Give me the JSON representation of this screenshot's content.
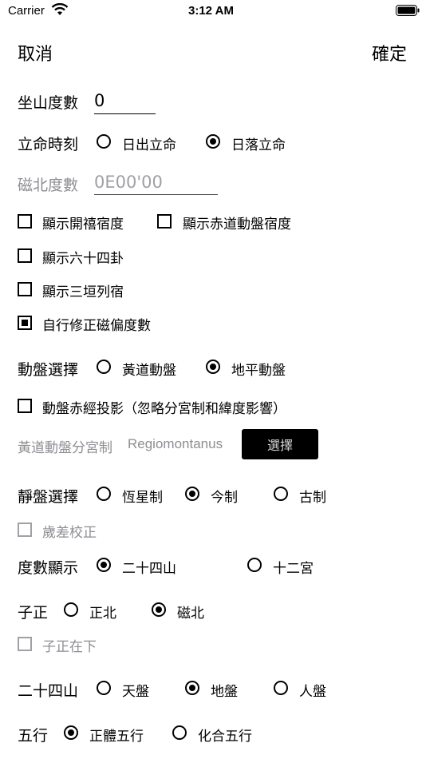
{
  "status_bar": {
    "carrier": "Carrier",
    "time": "3:12 AM"
  },
  "nav": {
    "cancel": "取消",
    "confirm": "確定"
  },
  "sitting_degree": {
    "label": "坐山度數",
    "value": "0"
  },
  "life_time": {
    "label": "立命時刻",
    "options": [
      "日出立命",
      "日落立命"
    ],
    "selected": "日落立命"
  },
  "magnetic_north": {
    "label": "磁北度數",
    "value": "0E00'00"
  },
  "checks": {
    "show_kaixi": "顯示開禧宿度",
    "show_equator": "顯示赤道動盤宿度",
    "show_64gua": "顯示六十四卦",
    "show_sanyuan": "顯示三垣列宿",
    "self_correct": "自行修正磁偏度數",
    "projection": "動盤赤經投影（忽略分宮制和緯度影響）",
    "precession": "歲差校正",
    "zizheng_below": "子正在下"
  },
  "moving_disc": {
    "label": "動盤選擇",
    "options": [
      "黃道動盤",
      "地平動盤"
    ],
    "selected": "地平動盤"
  },
  "house_system": {
    "label": "黃道動盤分宮制",
    "value": "Regiomontanus",
    "button": "選擇"
  },
  "static_disc": {
    "label": "靜盤選擇",
    "options": [
      "恆星制",
      "今制",
      "古制"
    ],
    "selected": "今制"
  },
  "degree_display": {
    "label": "度數顯示",
    "options": [
      "二十四山",
      "十二宮"
    ],
    "selected": "二十四山"
  },
  "zizheng": {
    "label": "子正",
    "options": [
      "正北",
      "磁北"
    ],
    "selected": "磁北"
  },
  "mountains24": {
    "label": "二十四山",
    "options": [
      "天盤",
      "地盤",
      "人盤"
    ],
    "selected": "地盤"
  },
  "five_elements": {
    "label": "五行",
    "options": [
      "正體五行",
      "化合五行"
    ],
    "selected": "正體五行"
  }
}
